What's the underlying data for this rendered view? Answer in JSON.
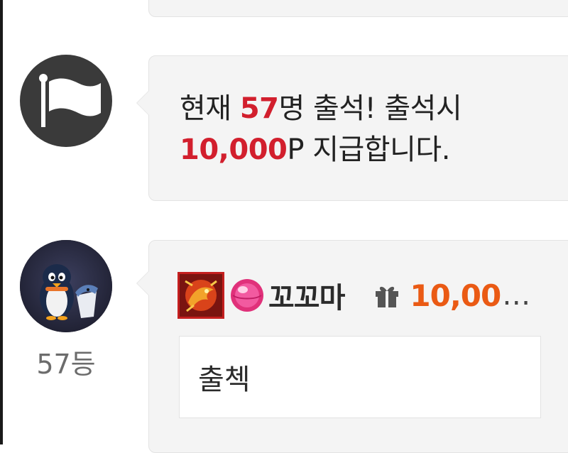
{
  "notice": {
    "icon": "flag-icon",
    "line1_prefix": "현재 ",
    "count": "57",
    "line1_suffix": "명 출석! 출석시",
    "reward": "10,000",
    "line2_suffix": "P 지급합니다."
  },
  "comment": {
    "rank": "57등",
    "nickname": "꼬꼬마",
    "points": "10,00",
    "ellipsis": "…",
    "text": "출첵",
    "icons": [
      "penguin-avatar",
      "dragon-badge-icon",
      "pink-orb-badge-icon",
      "gift-icon"
    ]
  },
  "colors": {
    "highlight_red": "#d21f2d",
    "points_orange": "#ea5a14",
    "card_bg": "#f4f4f4",
    "flag_avatar_bg": "#3a3a3a"
  }
}
